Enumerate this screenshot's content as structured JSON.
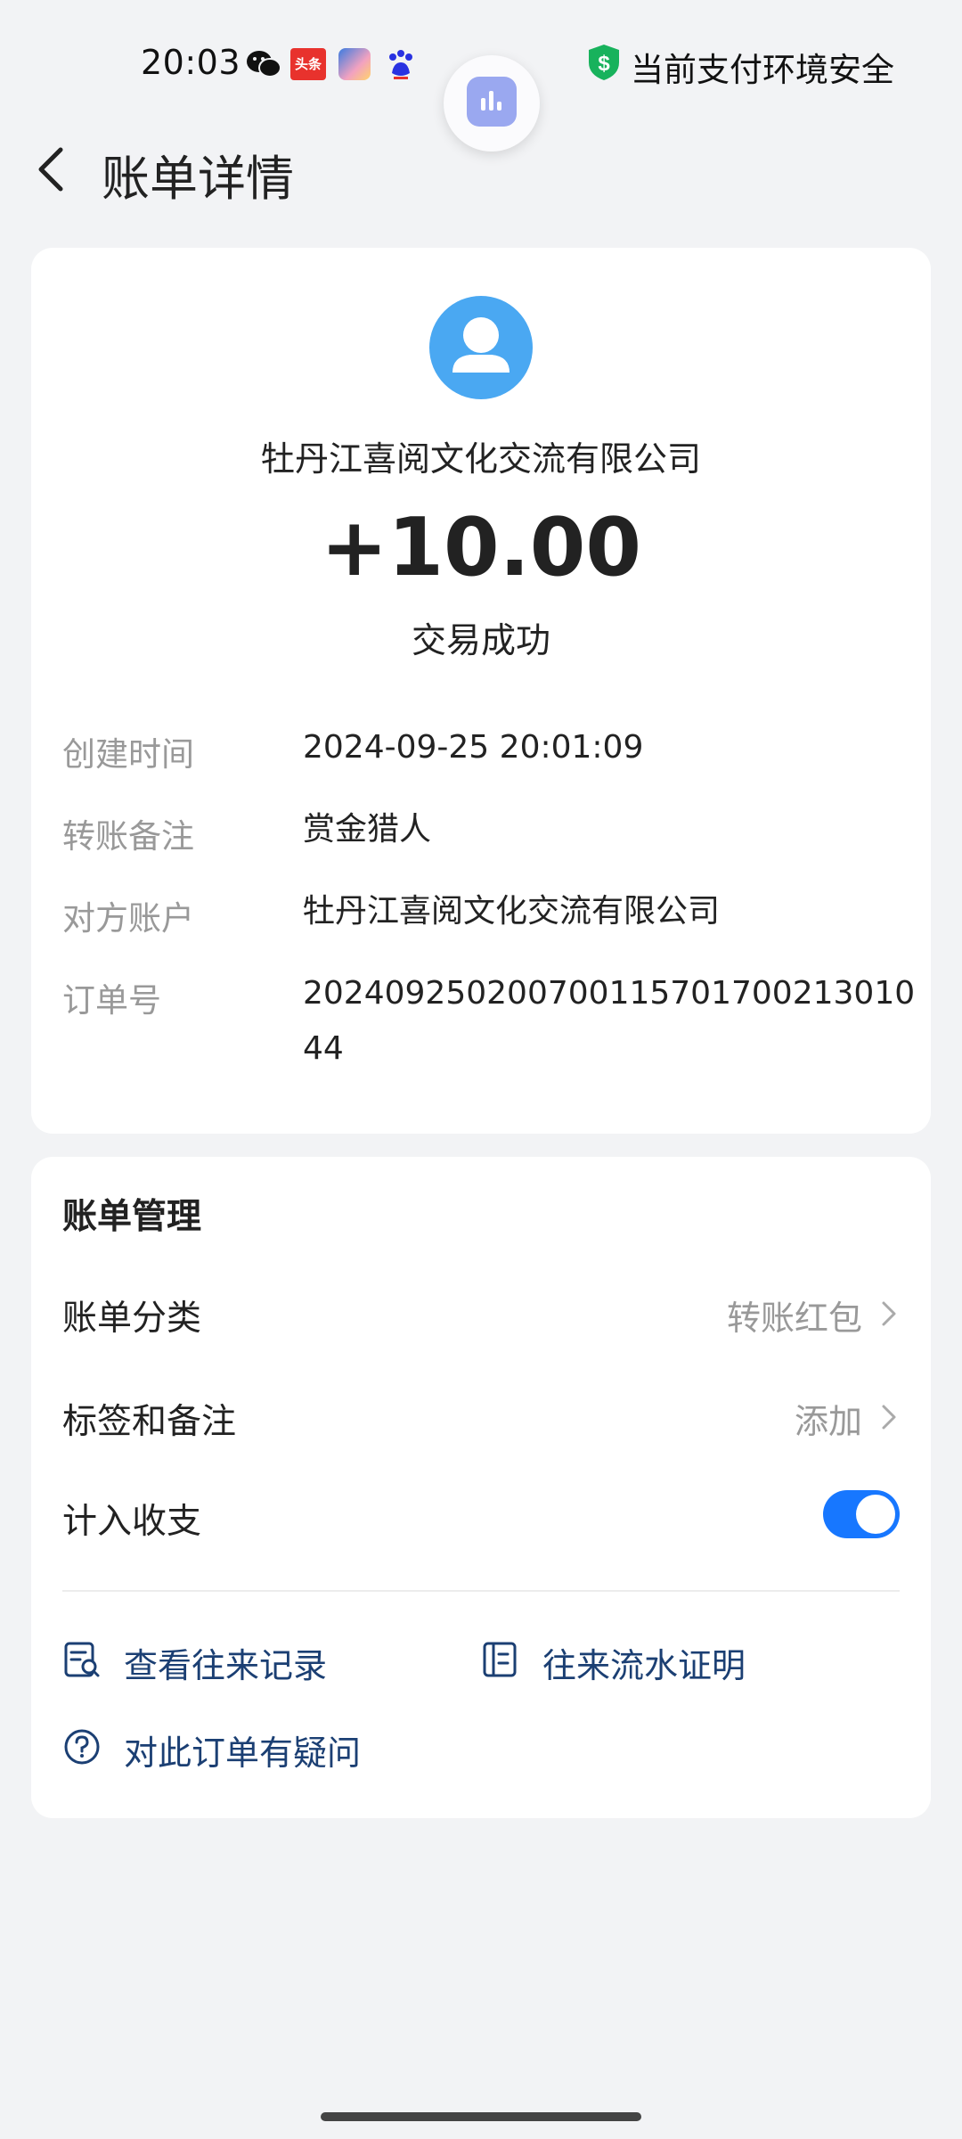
{
  "status_bar": {
    "time": "20:03",
    "notifications": [
      "wechat-icon",
      "toutiao-icon",
      "game-app-icon",
      "baidu-icon"
    ],
    "toutiao_label": "头条",
    "security_text": "当前支付环境安全"
  },
  "header": {
    "title": "账单详情"
  },
  "detail": {
    "payee": "牡丹江喜阅文化交流有限公司",
    "amount": "+10.00",
    "status": "交易成功",
    "rows": [
      {
        "label": "创建时间",
        "value": "2024-09-25 20:01:09"
      },
      {
        "label": "转账备注",
        "value": "赏金猎人"
      },
      {
        "label": "对方账户",
        "value": "牡丹江喜阅文化交流有限公司"
      },
      {
        "label": "订单号",
        "value": "20240925020070011570170021301044"
      }
    ]
  },
  "manage": {
    "title": "账单管理",
    "category_label": "账单分类",
    "category_value": "转账红包",
    "tags_label": "标签和备注",
    "tags_value": "添加",
    "count_label": "计入收支",
    "count_enabled": true,
    "link_records": "查看往来记录",
    "link_proof": "往来流水证明",
    "link_question": "对此订单有疑问"
  },
  "colors": {
    "accent": "#1777ff",
    "link": "#1b3f73",
    "avatar": "#4aa8f2",
    "secure": "#18b25c"
  }
}
